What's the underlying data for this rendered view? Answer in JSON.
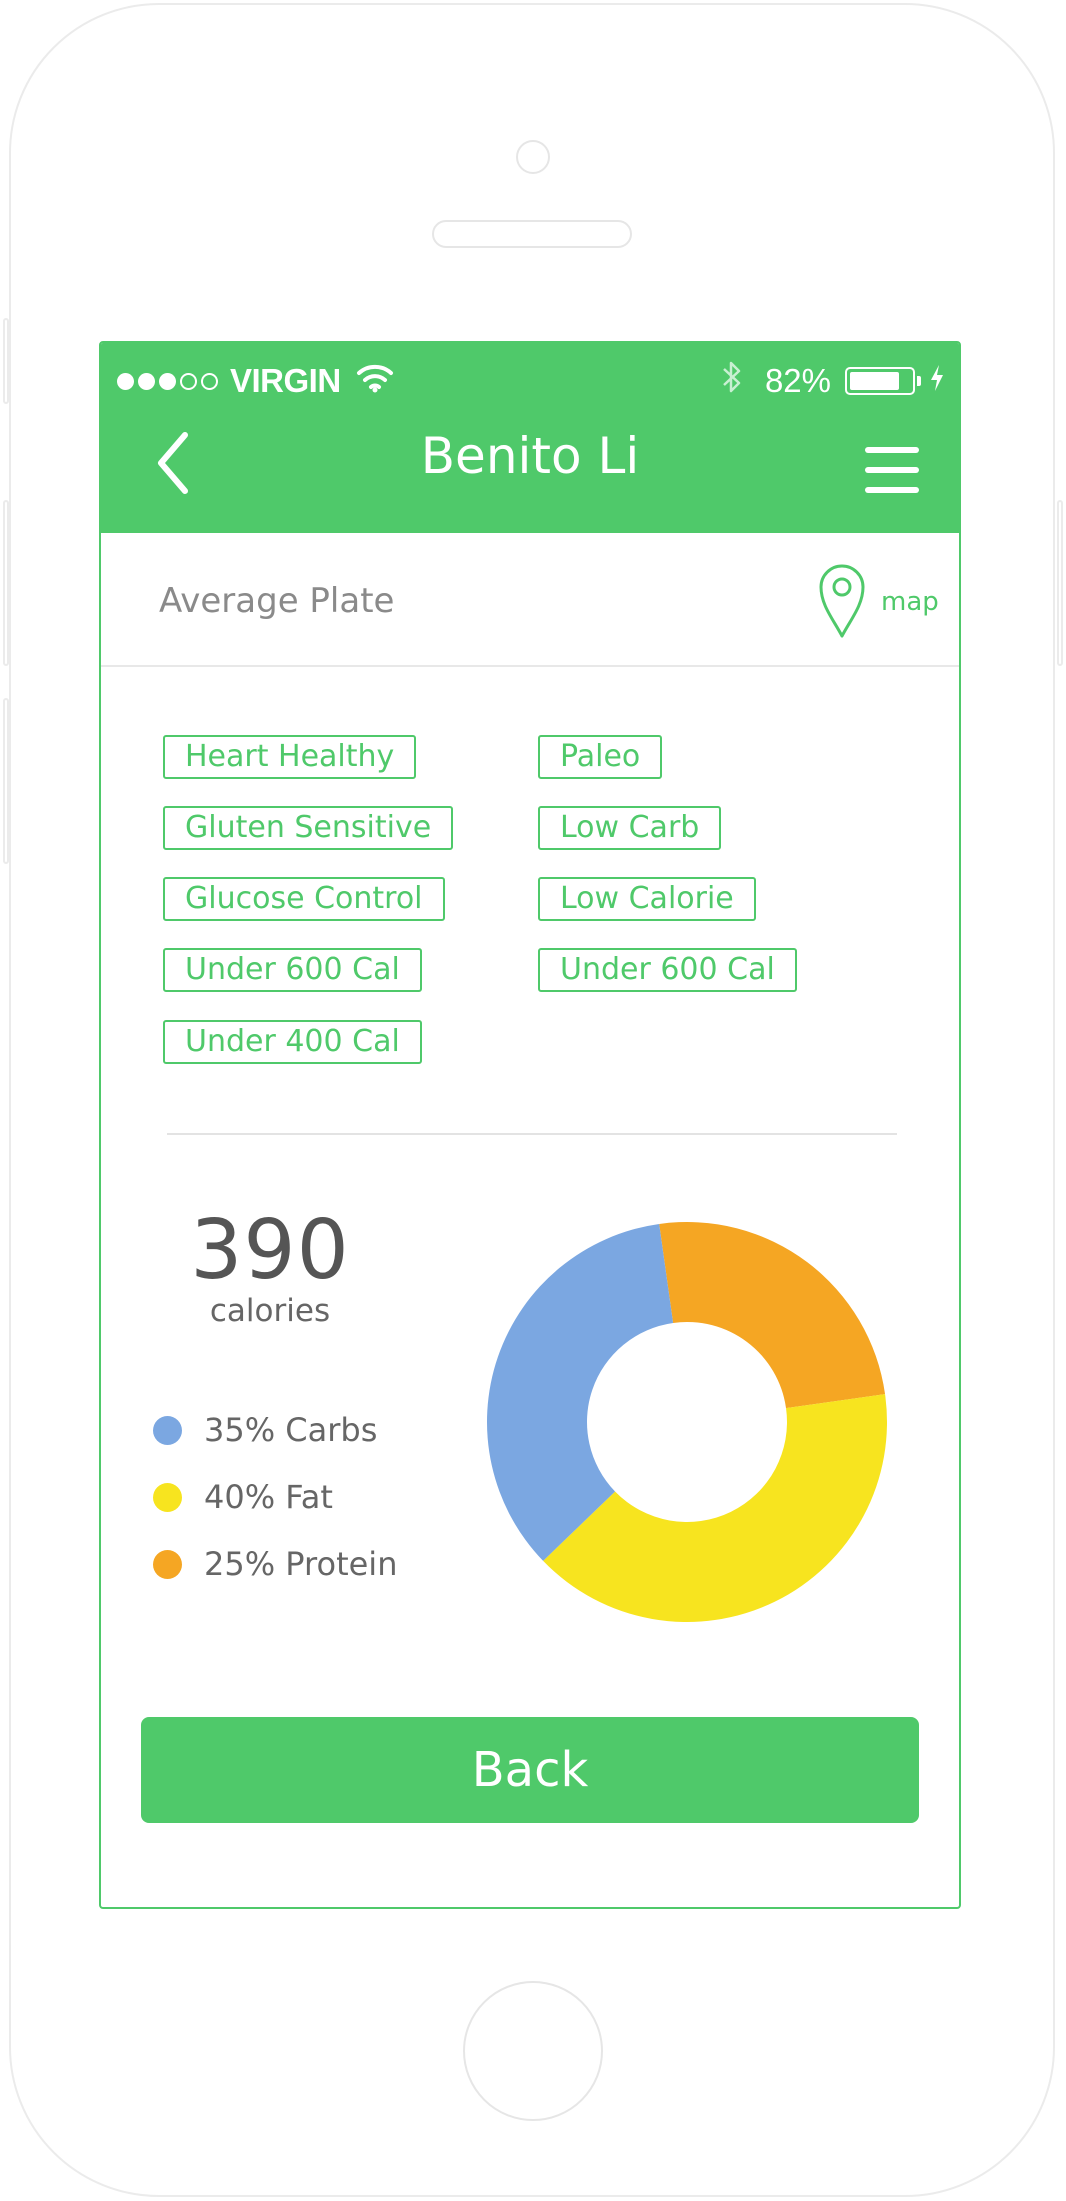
{
  "status_bar": {
    "signal_bars_filled": 3,
    "signal_bars_total": 5,
    "carrier": "VIRGIN",
    "battery_percent_label": "82%",
    "battery_level": 0.82
  },
  "nav": {
    "title": "Benito Li"
  },
  "section": {
    "title": "Average Plate",
    "map_label": "map"
  },
  "tags": {
    "left": [
      "Heart Healthy",
      "Gluten Sensitive",
      "Glucose Control",
      "Under 600 Cal",
      "Under 400 Cal"
    ],
    "right": [
      "Paleo",
      "Low Carb",
      "Low Calorie",
      "Under 600 Cal"
    ]
  },
  "calories": {
    "value": "390",
    "label": "calories"
  },
  "legend": [
    {
      "label": "35% Carbs",
      "color": "#7ba7e1"
    },
    {
      "label": "40% Fat",
      "color": "#f7e41f"
    },
    {
      "label": "25% Protein",
      "color": "#f5a623"
    }
  ],
  "chart_data": {
    "type": "pie",
    "donut": true,
    "categories": [
      "Carbs",
      "Fat",
      "Protein"
    ],
    "values": [
      35,
      40,
      25
    ],
    "colors": [
      "#7ba7e1",
      "#f7e41f",
      "#f5a623"
    ]
  },
  "buttons": {
    "back_label": "Back"
  },
  "colors": {
    "accent": "#4fc96a"
  }
}
